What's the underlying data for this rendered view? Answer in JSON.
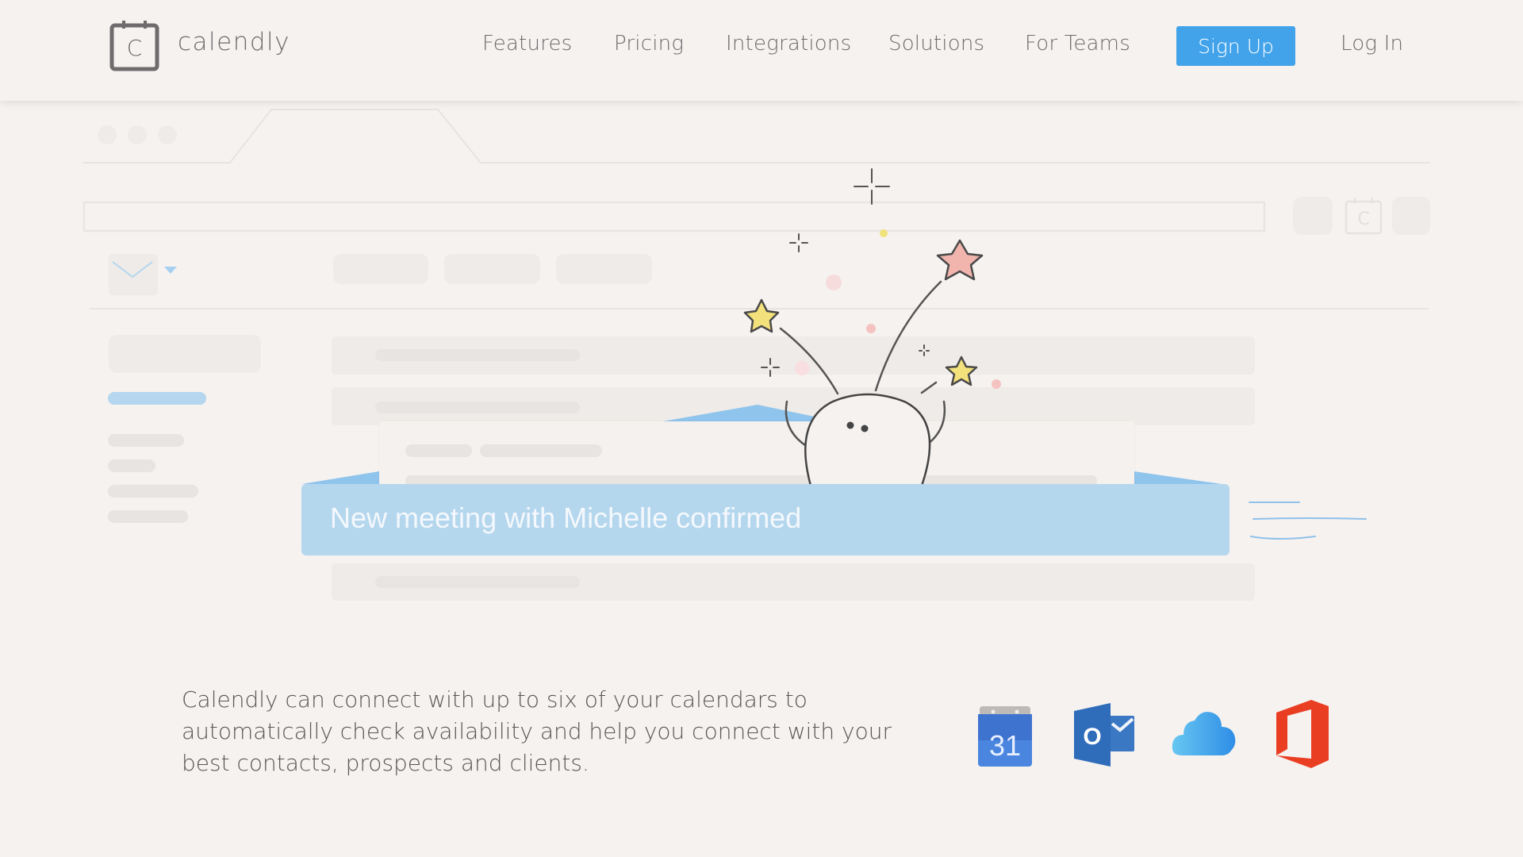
{
  "header": {
    "logo_text": "calendly",
    "logo_letter": "C",
    "nav": [
      {
        "label": "Features"
      },
      {
        "label": "Pricing"
      },
      {
        "label": "Integrations"
      },
      {
        "label": "Solutions"
      },
      {
        "label": "For Teams"
      }
    ],
    "signup_label": "Sign Up",
    "login_label": "Log In"
  },
  "illustration": {
    "notification_text": "New meeting with Michelle confirmed",
    "accent_color": "#42a3ea",
    "banner_color": "#b5d7ee",
    "toolbar_icon_letter": "C"
  },
  "main": {
    "description": "Calendly can connect with up to six of your calendars to automatically check availability and help you connect with your best contacts, prospects and clients.",
    "calendar_integrations": [
      {
        "name": "Google Calendar",
        "icon": "google-calendar-icon",
        "label": "31"
      },
      {
        "name": "Outlook",
        "icon": "outlook-icon",
        "label": "O"
      },
      {
        "name": "iCloud",
        "icon": "icloud-icon"
      },
      {
        "name": "Office 365",
        "icon": "office365-icon"
      }
    ]
  }
}
